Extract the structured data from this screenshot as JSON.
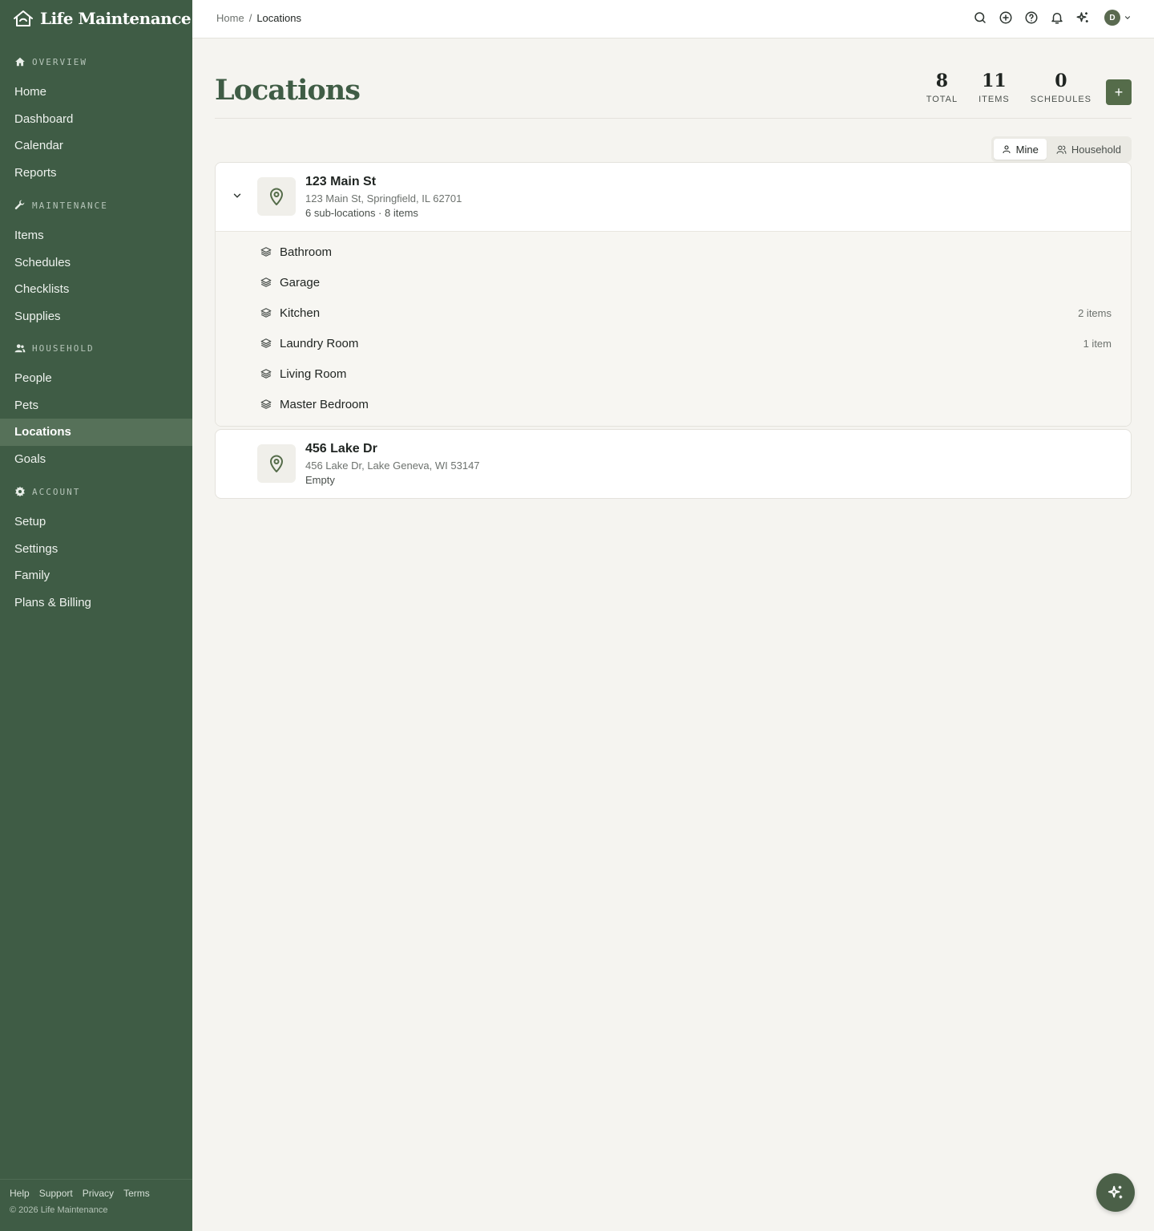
{
  "app": {
    "name": "Life Maintenance"
  },
  "colors": {
    "sidebar": "#3f5c45",
    "accent": "#556c4a",
    "title": "#3f5c45",
    "background": "#f5f4f0"
  },
  "sidebar": {
    "sections": [
      {
        "title": "OVERVIEW",
        "icon": "home-icon",
        "items": [
          {
            "label": "Home"
          },
          {
            "label": "Dashboard"
          },
          {
            "label": "Calendar"
          },
          {
            "label": "Reports"
          }
        ]
      },
      {
        "title": "MAINTENANCE",
        "icon": "wrench-icon",
        "items": [
          {
            "label": "Items"
          },
          {
            "label": "Schedules"
          },
          {
            "label": "Checklists"
          },
          {
            "label": "Supplies"
          }
        ]
      },
      {
        "title": "HOUSEHOLD",
        "icon": "users-icon",
        "items": [
          {
            "label": "People"
          },
          {
            "label": "Pets"
          },
          {
            "label": "Locations",
            "active": true
          },
          {
            "label": "Goals"
          }
        ]
      },
      {
        "title": "ACCOUNT",
        "icon": "gear-icon",
        "items": [
          {
            "label": "Setup"
          },
          {
            "label": "Settings"
          },
          {
            "label": "Family"
          },
          {
            "label": "Plans & Billing"
          }
        ]
      }
    ],
    "footer": {
      "links": [
        "Help",
        "Support",
        "Privacy",
        "Terms"
      ],
      "copyright": "© 2026 Life Maintenance"
    }
  },
  "topbar": {
    "breadcrumb": {
      "home": "Home",
      "separator": "/",
      "current": "Locations"
    },
    "icons": [
      "search-icon",
      "plus-circle-icon",
      "help-circle-icon",
      "bell-icon",
      "sparkles-icon"
    ],
    "avatar_initial": "D"
  },
  "page": {
    "title": "Locations",
    "stats": [
      {
        "value": "8",
        "label": "TOTAL"
      },
      {
        "value": "11",
        "label": "ITEMS"
      },
      {
        "value": "0",
        "label": "SCHEDULES"
      }
    ],
    "add_label": "+",
    "toggle": {
      "mine": "Mine",
      "household": "Household",
      "selected": "Mine"
    }
  },
  "locations": [
    {
      "name": "123 Main St",
      "address": "123 Main St, Springfield, IL 62701",
      "meta": "6 sub-locations · 8 items",
      "expanded": true,
      "sublocations": [
        {
          "name": "Bathroom",
          "count": ""
        },
        {
          "name": "Garage",
          "count": ""
        },
        {
          "name": "Kitchen",
          "count": "2 items"
        },
        {
          "name": "Laundry Room",
          "count": "1 item"
        },
        {
          "name": "Living Room",
          "count": ""
        },
        {
          "name": "Master Bedroom",
          "count": ""
        }
      ]
    },
    {
      "name": "456 Lake Dr",
      "address": "456 Lake Dr, Lake Geneva, WI 53147",
      "meta": "Empty",
      "expanded": false,
      "sublocations": []
    }
  ]
}
